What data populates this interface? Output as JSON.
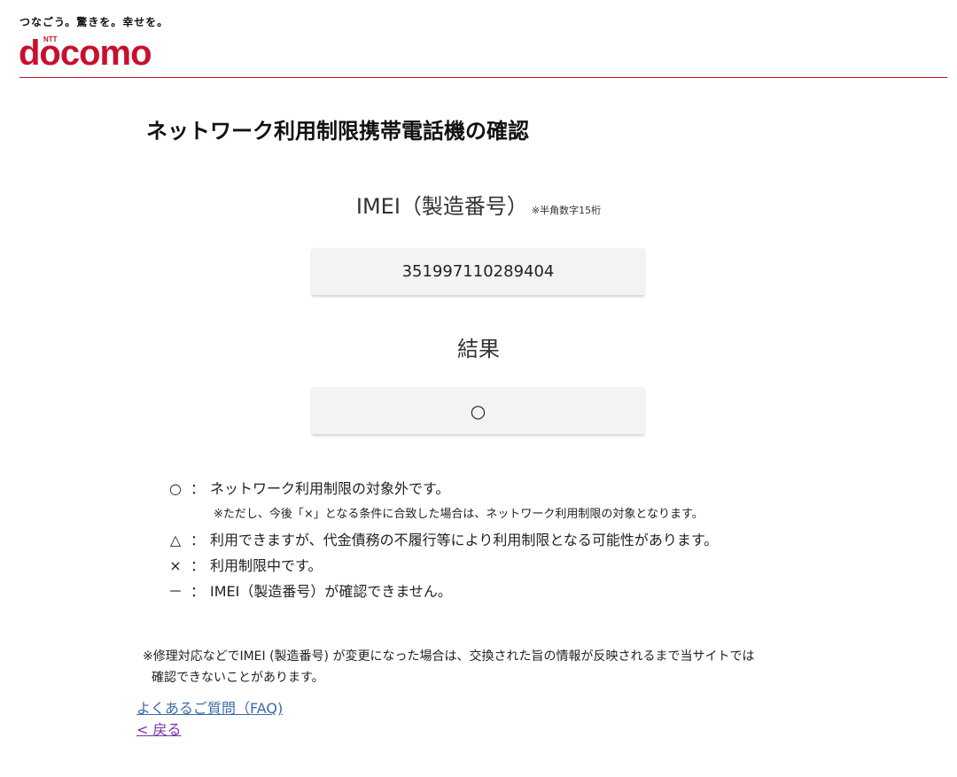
{
  "header": {
    "tagline": "つなごう。驚きを。幸せを。",
    "logo_brand": "docomo",
    "logo_ntt": "NTT",
    "accent_color": "#c8102e"
  },
  "page_title": "ネットワーク利用制限携帯電話機の確認",
  "imei": {
    "heading": "IMEI（製造番号）",
    "note": "※半角数字15桁",
    "value": "351997110289404"
  },
  "result": {
    "heading": "結果",
    "value": "○"
  },
  "legend": {
    "separator": "：",
    "items": [
      {
        "symbol": "○",
        "text": "ネットワーク利用制限の対象外です。"
      },
      {
        "symbol": "△",
        "text": "利用できますが、代金債務の不履行等により利用制限となる可能性があります。"
      },
      {
        "symbol": "×",
        "text": "利用制限中です。"
      },
      {
        "symbol": "－",
        "text": "IMEI（製造番号）が確認できません。"
      }
    ],
    "circle_note": "※ただし、今後「×」となる条件に合致した場合は、ネットワーク利用制限の対象となります。"
  },
  "footnote": {
    "line1": "※修理対応などでIMEI (製造番号) が変更になった場合は、交換された旨の情報が反映されるまで当サイトでは",
    "line2": "確認できないことがあります。"
  },
  "links": {
    "faq": "よくあるご質問（FAQ)",
    "back": "< 戻る"
  }
}
